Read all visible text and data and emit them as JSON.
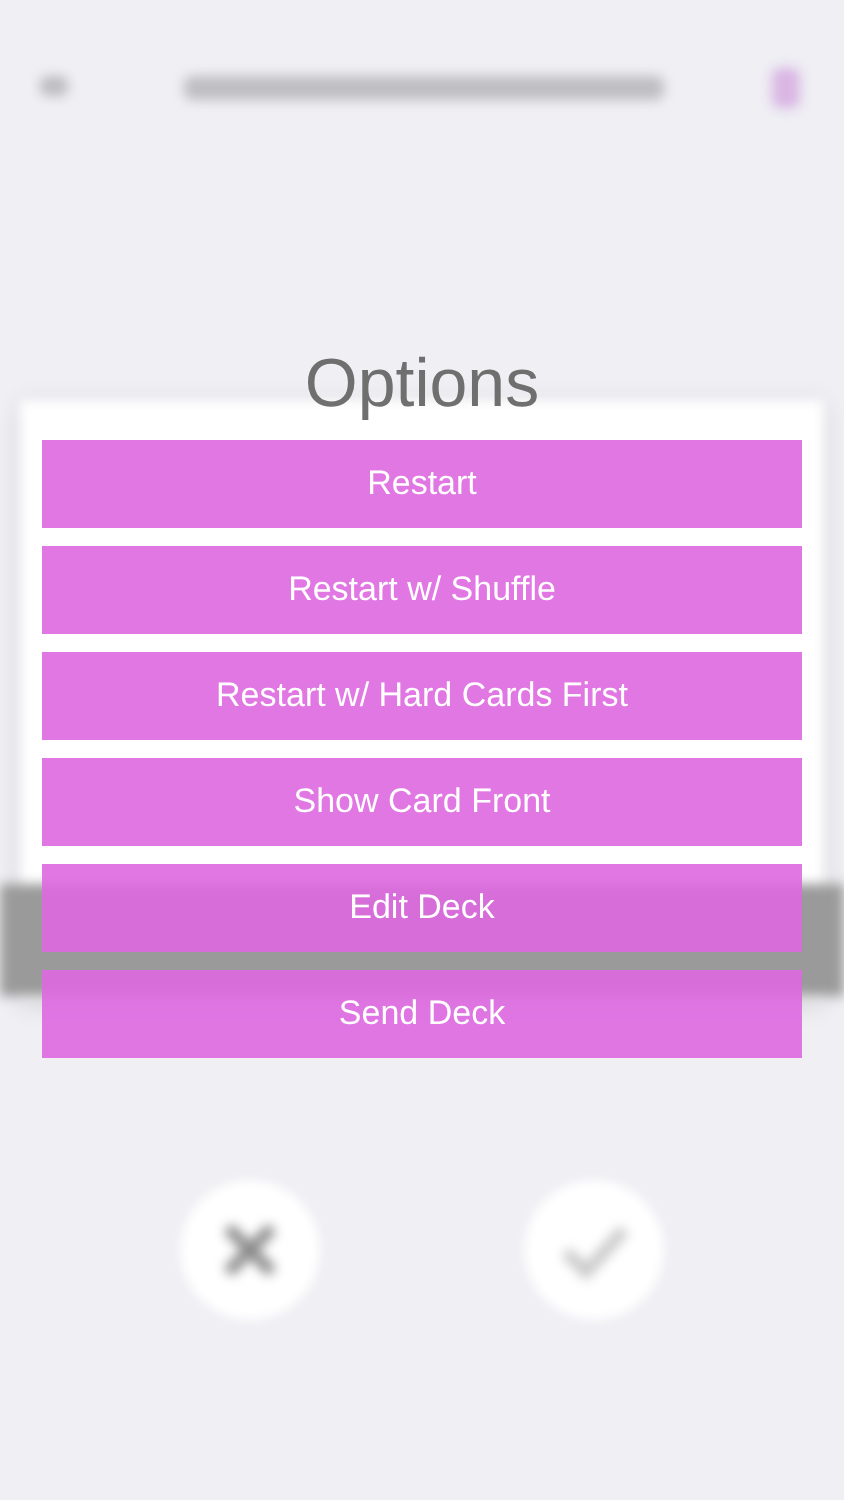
{
  "dialog": {
    "title": "Options",
    "options": [
      {
        "label": "Restart"
      },
      {
        "label": "Restart w/ Shuffle"
      },
      {
        "label": "Restart w/ Hard Cards First"
      },
      {
        "label": "Show Card Front"
      },
      {
        "label": "Edit Deck"
      },
      {
        "label": "Send Deck"
      }
    ]
  }
}
